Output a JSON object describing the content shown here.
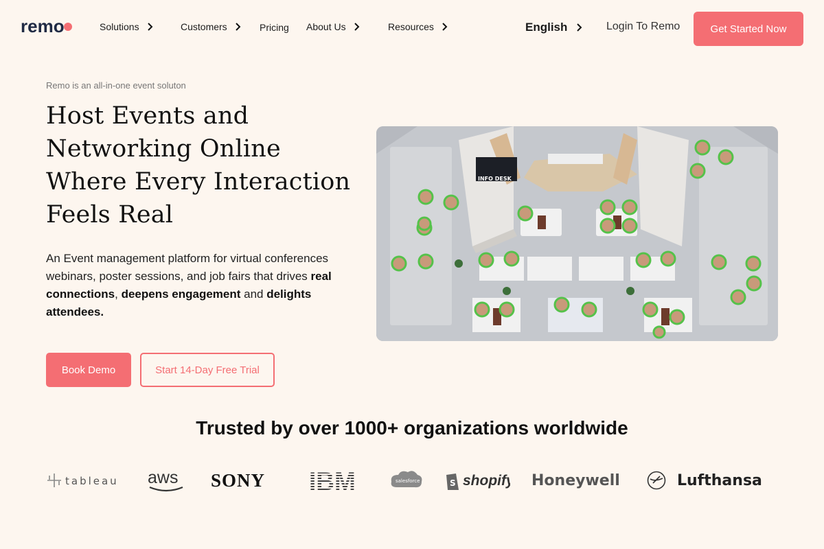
{
  "brand": {
    "logo_text": "remo",
    "accent": "#f46e73",
    "background": "#fdf6ef"
  },
  "nav": {
    "items": [
      {
        "label": "Solutions",
        "has_chevron": true
      },
      {
        "label": "Customers",
        "has_chevron": true
      },
      {
        "label": "Pricing",
        "has_chevron": false
      },
      {
        "label": "About Us",
        "has_chevron": true
      },
      {
        "label": "Resources",
        "has_chevron": true
      }
    ],
    "language": "English",
    "login": "Login To Remo",
    "cta": "Get Started Now"
  },
  "hero": {
    "eyebrow": "Remo is an all-in-one event soluton",
    "headline": "Host Events and Networking Online Where Every Interaction Feels Real",
    "desc_plain_1": "An Event management platform for virtual conferences webinars, poster sessions, and job fairs that drives ",
    "desc_bold_1": "real connections",
    "desc_plain_2": ", ",
    "desc_bold_2": "deepens engagement",
    "desc_plain_3": " and ",
    "desc_bold_3": "delights attendees.",
    "book_demo": "Book Demo",
    "free_trial": "Start 14-Day Free Trial",
    "floor_labels": {
      "info_desk": "INFO DESK"
    }
  },
  "trusted": {
    "heading": "Trusted by over 1000+ organizations worldwide",
    "logos": [
      "tableau",
      "aws",
      "SONY",
      "IBM",
      "salesforce",
      "shopify",
      "Honeywell",
      "Lufthansa"
    ]
  }
}
